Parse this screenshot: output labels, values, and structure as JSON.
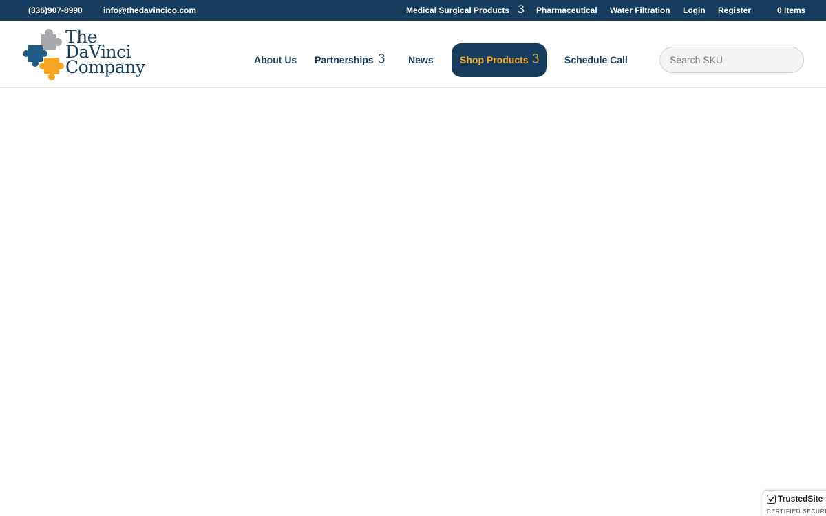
{
  "topbar": {
    "phone": "(336)907-8990",
    "email": "info@thedavincico.com",
    "links": {
      "medical": "Medical Surgical Products",
      "pharma": "Pharmaceutical",
      "water": "Water Filtration",
      "login": "Login",
      "register": "Register",
      "cart": "0 Items"
    },
    "chevron": "3"
  },
  "logo": {
    "line1": "The",
    "line2": "DaVinci",
    "line3": "Company",
    "colors": {
      "gray": "#a7a9ac",
      "blue": "#1f5b85",
      "navy": "#173d5e",
      "orange": "#f5a623"
    }
  },
  "nav": {
    "about": "About Us",
    "partnerships": "Partnerships",
    "news": "News",
    "shop": "Shop Products",
    "schedule": "Schedule Call",
    "chevron": "3"
  },
  "search": {
    "placeholder": "Search SKU",
    "value": ""
  },
  "badge": {
    "name": "TrustedSite",
    "sub": "CERTIFIED SECURE"
  },
  "colors": {
    "primary": "#173d5e",
    "accent": "#f5a623",
    "background": "#ffffff"
  }
}
